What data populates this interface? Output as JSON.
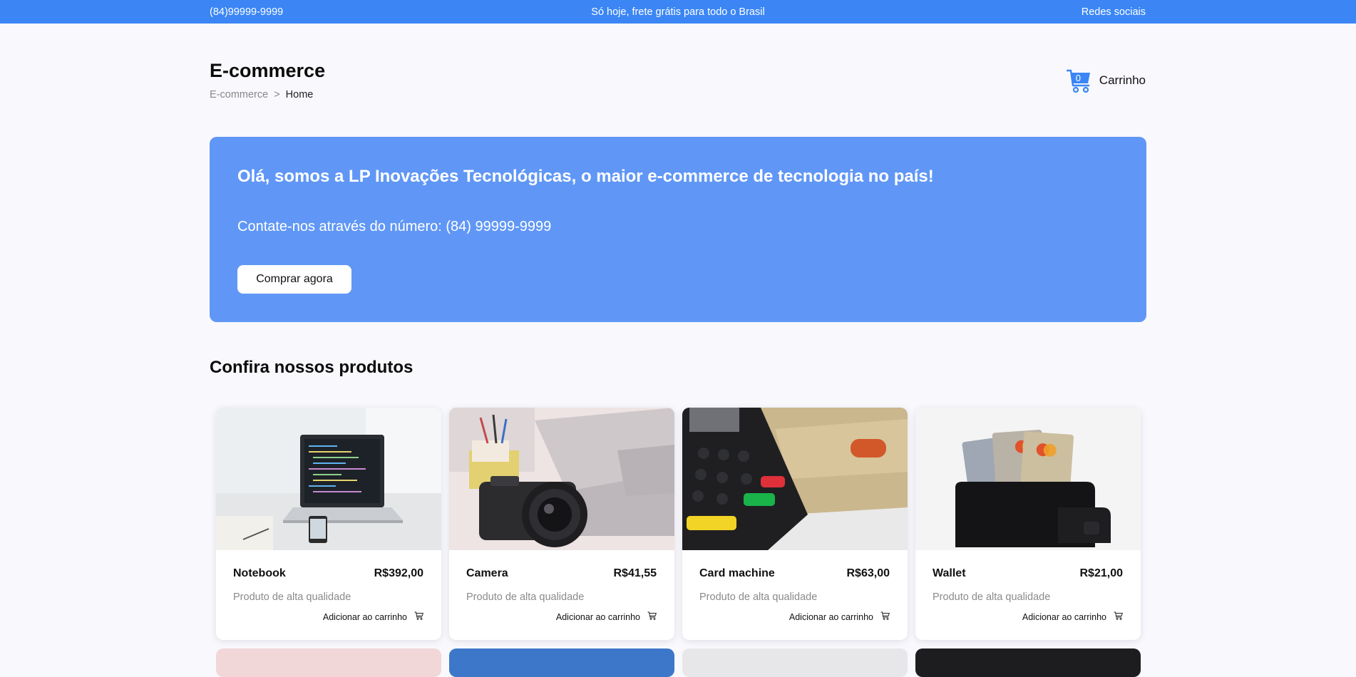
{
  "topbar": {
    "phone": "(84)99999-9999",
    "promo": "Só hoje, frete grátis para todo o Brasil",
    "social": "Redes sociais"
  },
  "header": {
    "title": "E-commerce",
    "breadcrumb": {
      "root": "E-commerce",
      "separator": ">",
      "current": "Home"
    },
    "cart": {
      "count": "0",
      "label": "Carrinho",
      "icon": "cart-icon"
    }
  },
  "hero": {
    "title": "Olá, somos a LP Inovações Tecnológicas, o maior e-commerce de tecnologia no país!",
    "contact": "Contate-nos através do número: (84) 99999-9999",
    "button": "Comprar agora"
  },
  "products_section": {
    "title": "Confira nossos produtos",
    "items": [
      {
        "name": "Notebook",
        "price": "R$392,00",
        "description": "Produto de alta qualidade",
        "add_label": "Adicionar ao carrinho",
        "image": "notebook-photo"
      },
      {
        "name": "Camera",
        "price": "R$41,55",
        "description": "Produto de alta qualidade",
        "add_label": "Adicionar ao carrinho",
        "image": "camera-photo"
      },
      {
        "name": "Card machine",
        "price": "R$63,00",
        "description": "Produto de alta qualidade",
        "add_label": "Adicionar ao carrinho",
        "image": "card-machine-photo"
      },
      {
        "name": "Wallet",
        "price": "R$21,00",
        "description": "Produto de alta qualidade",
        "add_label": "Adicionar ao carrinho",
        "image": "wallet-photo"
      }
    ]
  },
  "colors": {
    "topbar": "#3b86f4",
    "hero": "#6097f6",
    "accent": "#3b86f4",
    "background": "#f8f8fd"
  }
}
